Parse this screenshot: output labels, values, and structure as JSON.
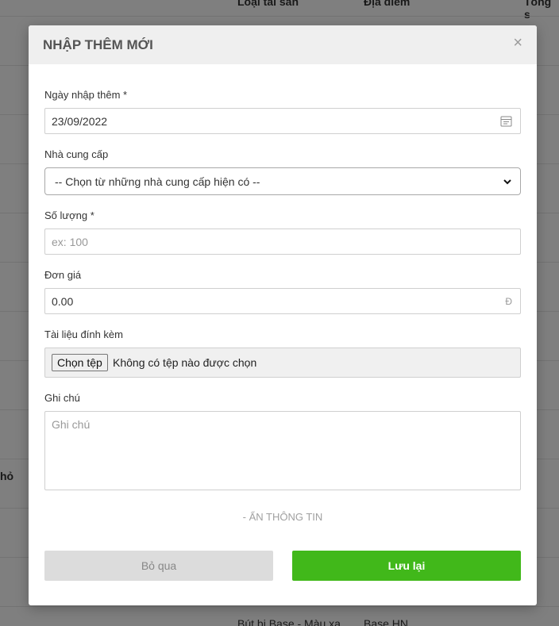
{
  "background": {
    "headers": [
      "Loại tài sản",
      "Địa điểm",
      "Tổng s"
    ],
    "partial_left_text": "hỏ",
    "bottom_row": [
      "Bút bi Base - Màu xa",
      "Base HN"
    ]
  },
  "modal": {
    "title": "NHẬP THÊM MỚI",
    "close_symbol": "×",
    "fields": {
      "import_date": {
        "label": "Ngày nhập thêm *",
        "value": "23/09/2022"
      },
      "supplier": {
        "label": "Nhà cung cấp",
        "selected": "-- Chọn từ những nhà cung cấp hiện có --"
      },
      "quantity": {
        "label": "Số lượng *",
        "placeholder": "ex: 100"
      },
      "unit_price": {
        "label": "Đơn giá",
        "value": "0.00",
        "currency": "Đ"
      },
      "attachment": {
        "label": "Tài liệu đính kèm",
        "button_label": "Chọn tệp",
        "status": "Không có tệp nào được chọn"
      },
      "note": {
        "label": "Ghi chú",
        "placeholder": "Ghi chú"
      }
    },
    "toggle_label": "- ẨN THÔNG TIN",
    "buttons": {
      "cancel": "Bỏ qua",
      "save": "Lưu lại"
    }
  },
  "colors": {
    "primary_green": "#41b81a",
    "header_bg": "#efefef",
    "cancel_bg": "#dcdcdc"
  }
}
